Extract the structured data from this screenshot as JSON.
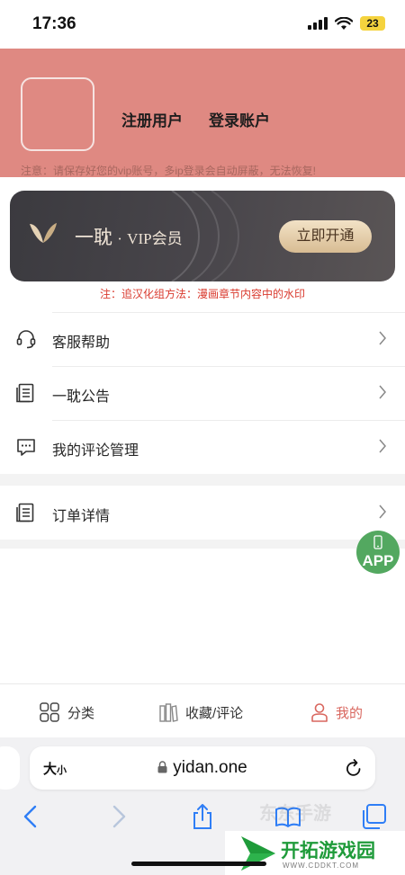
{
  "status": {
    "time": "17:36",
    "battery": "23"
  },
  "header": {
    "register": "注册用户",
    "login": "登录账户",
    "notice": "注意：请保存好您的vip账号，多ip登录会自动屏蔽，无法恢复!"
  },
  "vip": {
    "brand": "一耽",
    "separator": "·",
    "member": "VIP会员",
    "button": "立即开通",
    "note": "注：追汉化组方法：漫画章节内容中的水印"
  },
  "menu": [
    {
      "label": "客服帮助",
      "icon": "headset-icon"
    },
    {
      "label": "一耽公告",
      "icon": "document-icon"
    },
    {
      "label": "我的评论管理",
      "icon": "comment-icon"
    },
    {
      "label": "订单详情",
      "icon": "document-icon"
    }
  ],
  "float_button": {
    "label": "APP"
  },
  "tabbar": [
    {
      "label": "分类",
      "icon": "grid-icon",
      "active": false
    },
    {
      "label": "收藏/评论",
      "icon": "books-icon",
      "active": false
    },
    {
      "label": "我的",
      "icon": "user-icon",
      "active": true
    }
  ],
  "browser": {
    "text_size_big": "大",
    "text_size_small": "小",
    "url": "yidan.one"
  },
  "watermark": {
    "name": "开拓游戏园",
    "site": "WWW.CDDKT.COM",
    "faint": "东东手游"
  },
  "colors": {
    "header_bg": "#df8982",
    "accent": "#d9675f",
    "notice_red": "#d93a2e",
    "app_green": "#53a860"
  }
}
